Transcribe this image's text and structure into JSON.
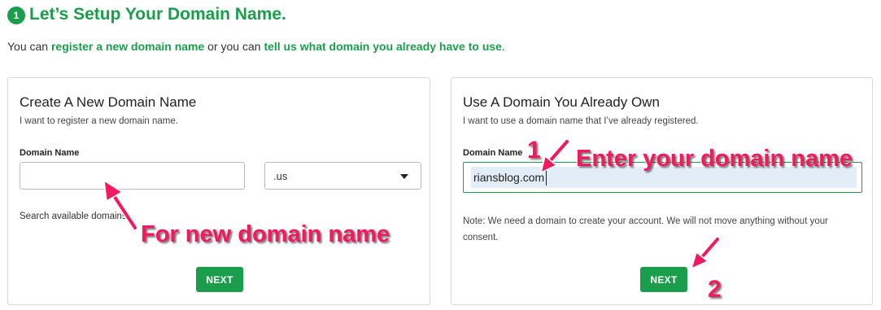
{
  "header": {
    "step_number": "1",
    "title": "Let’s Setup Your Domain Name.",
    "intro_prefix": "You can ",
    "intro_link_register": "register a new domain name",
    "intro_middle": " or you can ",
    "intro_link_existing": "tell us what domain you already have to use",
    "intro_suffix": "."
  },
  "new_domain_card": {
    "title": "Create A New Domain Name",
    "subtitle": "I want to register a new domain name.",
    "field_label": "Domain Name",
    "input_value": "",
    "tld_selected": ".us",
    "search_text": "Search available domains",
    "next_label": "NEXT"
  },
  "existing_domain_card": {
    "title": "Use A Domain You Already Own",
    "subtitle": "I want to use a domain name that I’ve already registered.",
    "field_label": "Domain Name",
    "input_value": "riansblog.com",
    "note": "Note: We need a domain to create your account. We will not move anything without your consent.",
    "next_label": "NEXT"
  },
  "annotations": {
    "new_domain": "For new domain name",
    "enter_domain": "Enter your domain name",
    "step_1": "1",
    "step_2": "2",
    "color": "#f2195e"
  },
  "colors": {
    "brand_green": "#1a9e4b",
    "input_highlight": "#e3edf8"
  }
}
